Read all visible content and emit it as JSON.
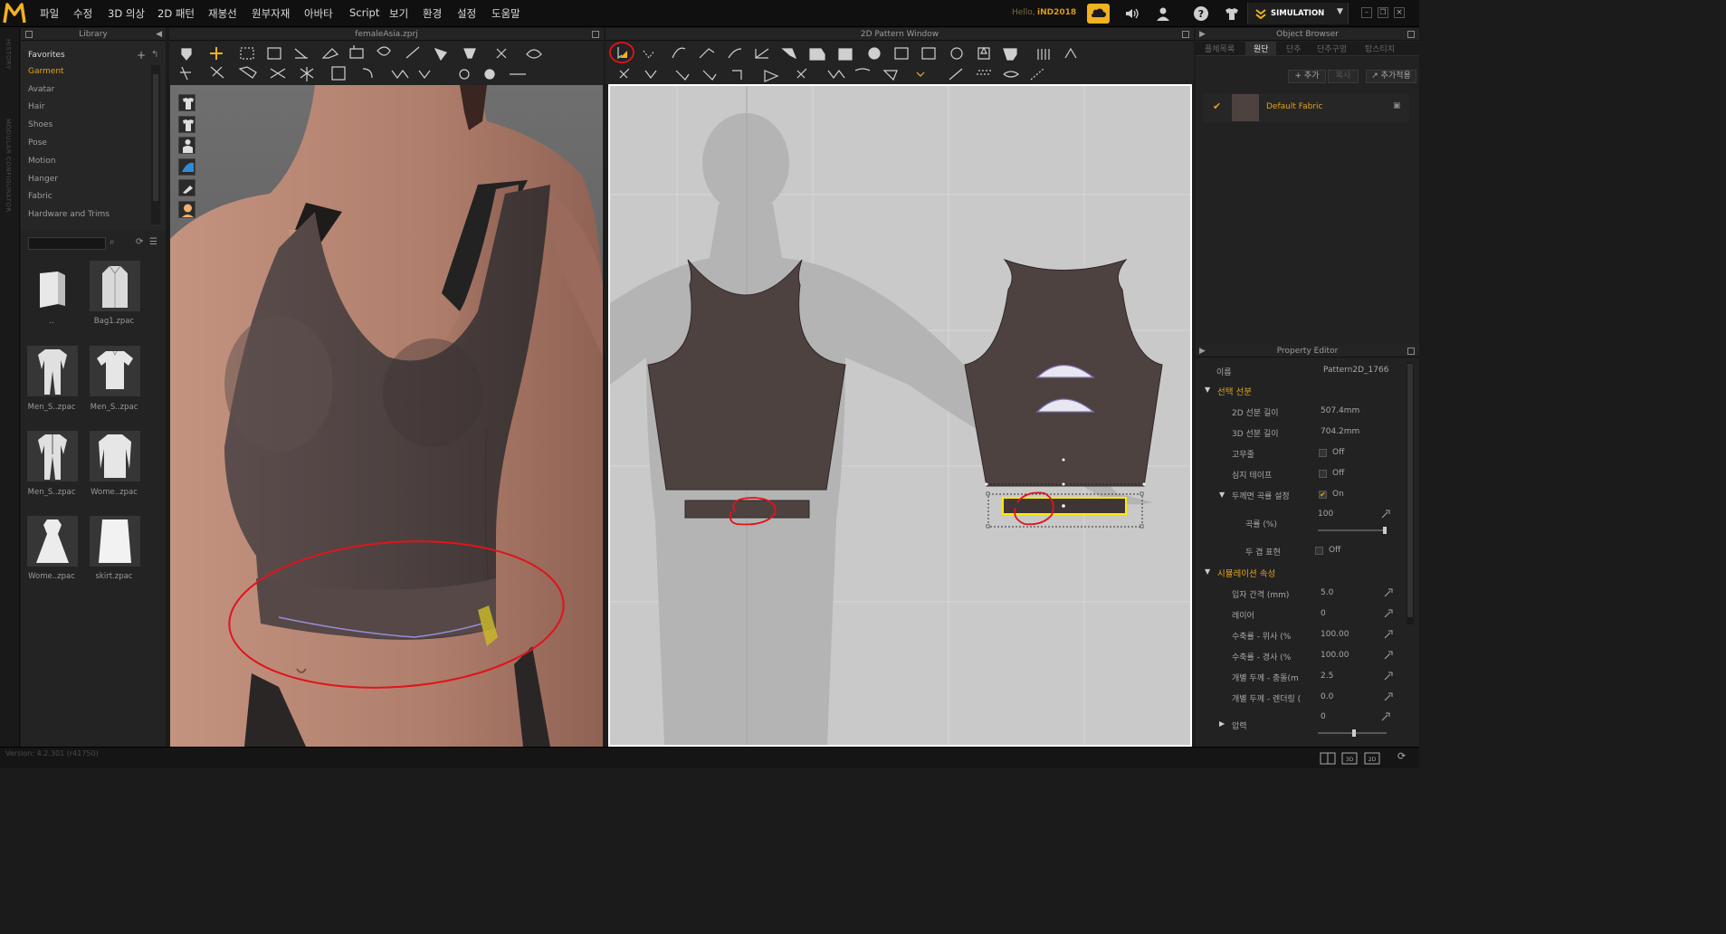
{
  "menubar": {
    "items": [
      "파일",
      "수정",
      "3D 의상",
      "2D 패턴",
      "재봉선",
      "원부자재",
      "아바타",
      "Script",
      "보기",
      "환경",
      "설정",
      "도움말"
    ],
    "greeting": "Hello,",
    "username": "iND2018",
    "mode": "SIMULATION"
  },
  "left_strip": {
    "history": "HISTORY",
    "modular": "MODULAR CONFIGURATOR"
  },
  "library": {
    "title": "Library",
    "categories": [
      "Favorites",
      "Garment",
      "Avatar",
      "Hair",
      "Shoes",
      "Pose",
      "Motion",
      "Hanger",
      "Fabric",
      "Hardware and Trims"
    ],
    "selected_category": "Garment",
    "search_placeholder": "",
    "items": [
      {
        "label": "..",
        "icon": "folder-icon"
      },
      {
        "label": "Bag1.zpac",
        "icon": "bag-icon"
      },
      {
        "label": "Men_S..zpac",
        "icon": "suit-icon"
      },
      {
        "label": "Men_S..zpac",
        "icon": "shirt-icon"
      },
      {
        "label": "Men_S..zpac",
        "icon": "suit-icon"
      },
      {
        "label": "Wome..zpac",
        "icon": "coat-icon"
      },
      {
        "label": "Wome..zpac",
        "icon": "dress-icon"
      },
      {
        "label": "skirt.zpac",
        "icon": "skirt-icon"
      }
    ]
  },
  "view3d": {
    "title": "femaleAsia.zprj"
  },
  "view2d": {
    "title": "2D Pattern Window"
  },
  "object_browser": {
    "title": "Object Browser",
    "tabs": [
      "플체목록",
      "원단",
      "단추",
      "단추구멍",
      "탑스티치"
    ],
    "active_tab": "원단",
    "add_label": "+ 추가",
    "copy_label": "복사",
    "add_apply_label": "추가적용",
    "fabric_name": "Default Fabric"
  },
  "property_editor": {
    "title": "Property Editor",
    "name_label": "이름",
    "name_value": "Pattern2D_1766",
    "section_line": "선택 선분",
    "rows_line": [
      {
        "label": "2D 선분 길이",
        "value": "507.4mm"
      },
      {
        "label": "3D 선분 길이",
        "value": "704.2mm"
      },
      {
        "label": "고무줄",
        "value": "Off"
      },
      {
        "label": "심지 테이프",
        "value": "Off"
      },
      {
        "label": "두께면 곡률 설정",
        "value": "On"
      },
      {
        "label": "곡률 (%)",
        "value": "100"
      },
      {
        "label": "두 겹 표현",
        "value": "Off"
      }
    ],
    "section_sim": "시뮬레이션 속성",
    "rows_sim": [
      {
        "label": "입자 간격 (mm)",
        "value": "5.0"
      },
      {
        "label": "레이어",
        "value": "0"
      },
      {
        "label": "수축률 - 위사 (%",
        "value": "100.00"
      },
      {
        "label": "수축률 - 경사 (%",
        "value": "100.00"
      },
      {
        "label": "개별 두께 - 충돌(m",
        "value": "2.5"
      },
      {
        "label": "개별 두께 - 렌더링 (",
        "value": "0.0"
      },
      {
        "label": "압력",
        "value": "0"
      }
    ]
  },
  "status": {
    "version": "Version: 4.2.301 (r41750)"
  },
  "colors": {
    "accent": "#e0a21c",
    "fabric": "#4e4241",
    "annotation": "#e0141b",
    "selection": "#ffea00"
  }
}
